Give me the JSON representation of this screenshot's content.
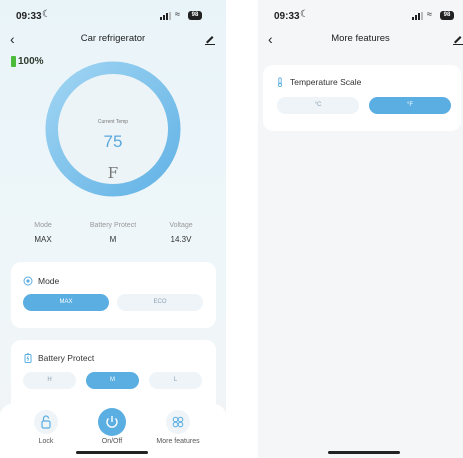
{
  "left_screen": {
    "status": {
      "time": "09:33",
      "battery": "98"
    },
    "nav": {
      "title": "Car refrigerator"
    },
    "battery_level": "100%",
    "gauge": {
      "label": "Current Temp",
      "value": "75",
      "unit": "F"
    },
    "stats": [
      {
        "label": "Mode",
        "value": "MAX"
      },
      {
        "label": "Battery Protect",
        "value": "M"
      },
      {
        "label": "Voltage",
        "value": "14.3V"
      }
    ],
    "mode_card": {
      "title": "Mode",
      "options": [
        "MAX",
        "ECO"
      ],
      "selected": "MAX"
    },
    "battery_card": {
      "title": "Battery Protect",
      "options": [
        "H",
        "M",
        "L"
      ],
      "selected": "M"
    },
    "tabbar": {
      "lock": "Lock",
      "onoff": "On/Off",
      "more": "More features"
    }
  },
  "right_screen": {
    "status": {
      "time": "09:33",
      "battery": "98"
    },
    "nav": {
      "title": "More features"
    },
    "temp_card": {
      "title": "Temperature Scale",
      "options": [
        "°C",
        "°F"
      ],
      "selected": "°F"
    }
  },
  "colors": {
    "accent": "#5aaee2",
    "battery_green": "#4cba3a"
  }
}
